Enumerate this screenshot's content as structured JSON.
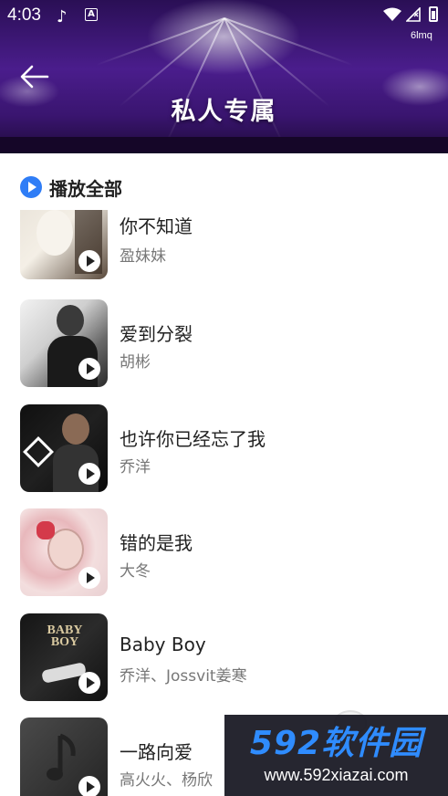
{
  "status_bar": {
    "time": "4:03",
    "net_speed": "6lmq",
    "icons": [
      "music-note-icon",
      "a-badge-icon",
      "wifi-icon",
      "signal-off-icon",
      "battery-icon"
    ]
  },
  "header": {
    "title": "私人专属",
    "back_icon": "back-arrow-icon"
  },
  "play_all": {
    "label": "播放全部",
    "icon": "play-circle-icon",
    "accent": "#2f7df6"
  },
  "songs": [
    {
      "title": "你不知道",
      "artist": "盈妹妹"
    },
    {
      "title": "爱到分裂",
      "artist": "胡彬"
    },
    {
      "title": "也许你已经忘了我",
      "artist": "乔洋"
    },
    {
      "title": "错的是我",
      "artist": "大冬"
    },
    {
      "title": "Baby Boy",
      "artist": "乔洋、Jossvit姜寒"
    },
    {
      "title": "一路向爱",
      "artist": "高火火、杨欣"
    }
  ],
  "watermark": {
    "brand": "592软件园",
    "url": "www.592xiazai.com"
  },
  "colors": {
    "header_purple": "#4a1d8c",
    "title_text": "#222222",
    "artist_text": "#777777"
  }
}
